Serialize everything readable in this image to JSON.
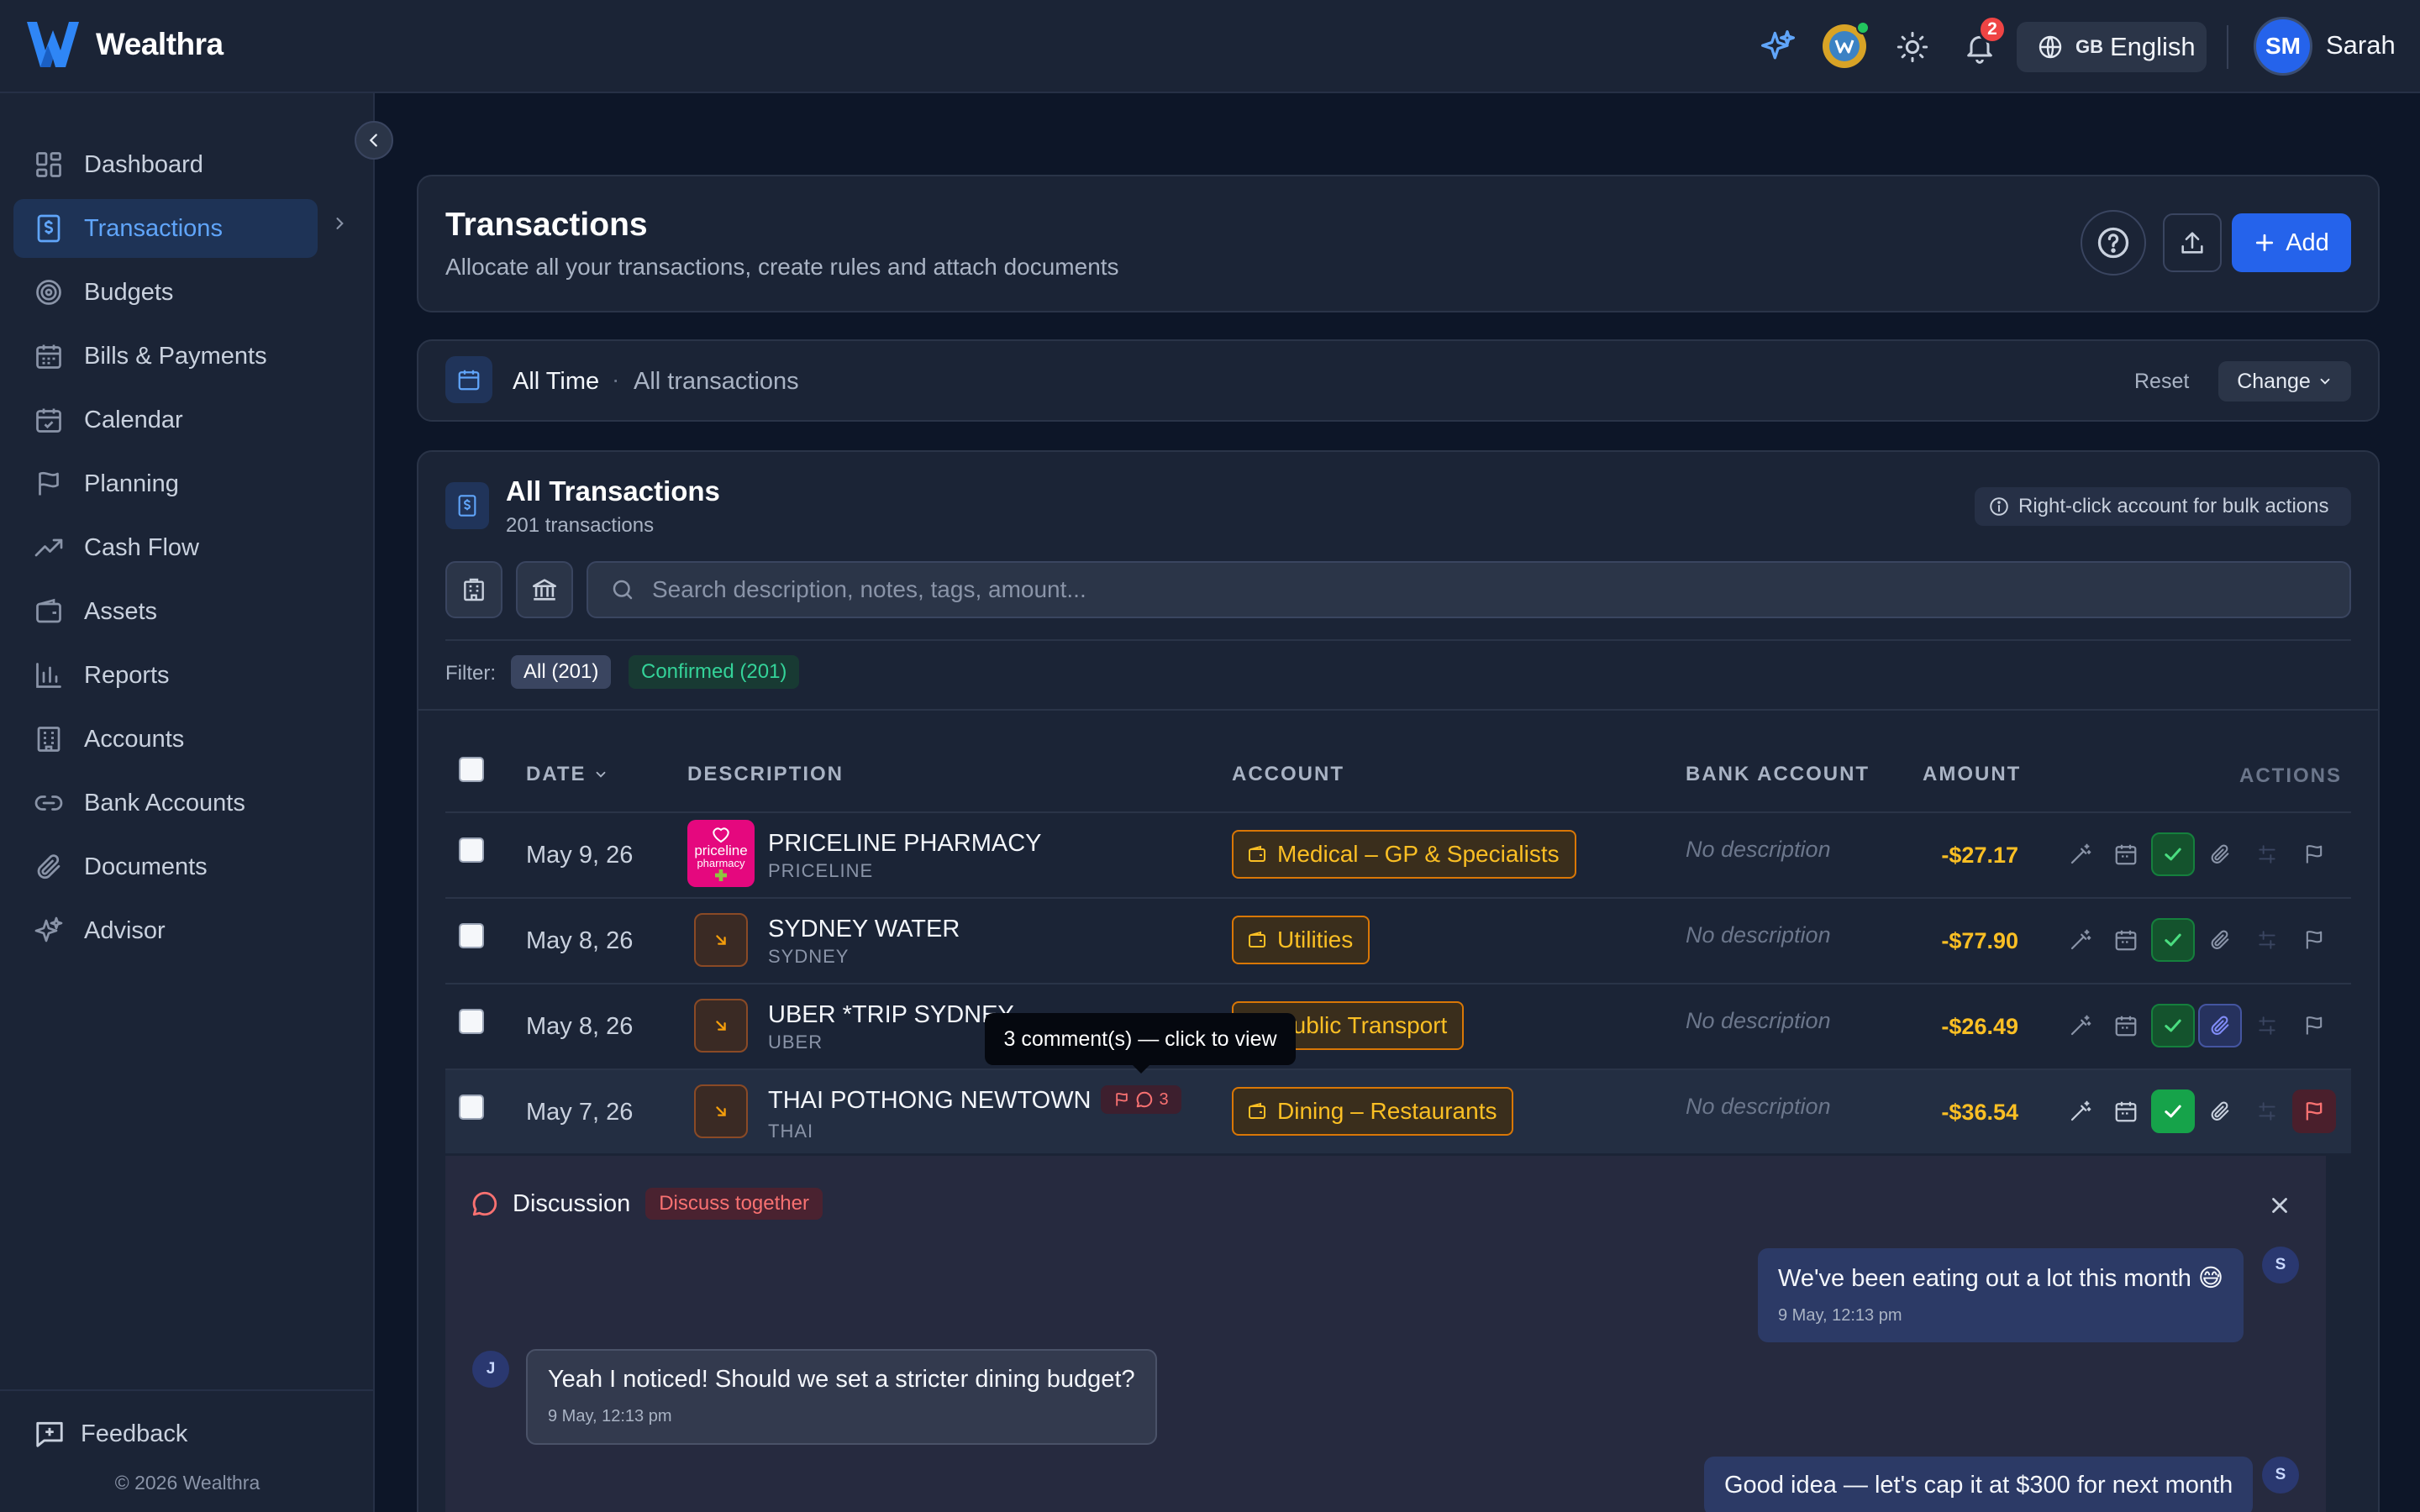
{
  "app": {
    "name": "Wealthra"
  },
  "topbar": {
    "notifications_count": "2",
    "language_flag": "GB",
    "language_label": "English",
    "user_initials": "SM",
    "user_name": "Sarah"
  },
  "sidebar": {
    "items": [
      {
        "label": "Dashboard",
        "icon": "dashboard-icon"
      },
      {
        "label": "Transactions",
        "icon": "receipt-dollar-icon",
        "active": true
      },
      {
        "label": "Budgets",
        "icon": "target-icon"
      },
      {
        "label": "Bills & Payments",
        "icon": "calendar-grid-icon"
      },
      {
        "label": "Calendar",
        "icon": "calendar-check-icon"
      },
      {
        "label": "Planning",
        "icon": "flag-icon"
      },
      {
        "label": "Cash Flow",
        "icon": "trending-up-icon"
      },
      {
        "label": "Assets",
        "icon": "wallet-icon"
      },
      {
        "label": "Reports",
        "icon": "bar-chart-icon"
      },
      {
        "label": "Accounts",
        "icon": "building-icon"
      },
      {
        "label": "Bank Accounts",
        "icon": "link-icon"
      },
      {
        "label": "Documents",
        "icon": "paperclip-icon"
      },
      {
        "label": "Advisor",
        "icon": "sparkles-icon"
      }
    ],
    "feedback_label": "Feedback",
    "copyright": "© 2026 Wealthra"
  },
  "header": {
    "title": "Transactions",
    "subtitle": "Allocate all your transactions, create rules and attach documents",
    "add_label": "Add"
  },
  "date_range": {
    "label": "All Time",
    "separator": "·",
    "sublabel": "All transactions",
    "reset_label": "Reset",
    "change_label": "Change"
  },
  "transactions": {
    "title": "All Transactions",
    "count": "201 transactions",
    "bulk_hint": "Right-click account for bulk actions",
    "search_placeholder": "Search description, notes, tags, amount...",
    "filter_label": "Filter:",
    "filters": {
      "all": "All (201)",
      "confirmed": "Confirmed (201)"
    },
    "columns": {
      "date": "DATE",
      "description": "DESCRIPTION",
      "account": "ACCOUNT",
      "bank_account": "BANK ACCOUNT",
      "amount": "AMOUNT",
      "actions": "ACTIONS"
    },
    "rows": [
      {
        "date": "May 9, 26",
        "name": "PRICELINE PHARMACY",
        "sub": "PRICELINE",
        "account": "Medical – GP & Specialists",
        "bank": "No description",
        "amount": "-$27.17"
      },
      {
        "date": "May 8, 26",
        "name": "SYDNEY WATER",
        "sub": "SYDNEY",
        "account": "Utilities",
        "bank": "No description",
        "amount": "-$77.90"
      },
      {
        "date": "May 8, 26",
        "name": "UBER *TRIP SYDNEY",
        "sub": "UBER",
        "account": "Public Transport",
        "bank": "No description",
        "amount": "-$26.49"
      },
      {
        "date": "May 7, 26",
        "name": "THAI POTHONG NEWTOWN",
        "sub": "THAI",
        "account": "Dining – Restaurants",
        "bank": "No description",
        "amount": "-$36.54",
        "comments": "3"
      }
    ],
    "logo_text": {
      "line1": "priceline",
      "line2": "pharmacy"
    },
    "tooltip": "3 comment(s) — click to view"
  },
  "discussion": {
    "title": "Discussion",
    "tag": "Discuss together",
    "messages": [
      {
        "author": "S",
        "text": "We've been eating out a lot this month 😅",
        "time": "9 May, 12:13 pm"
      },
      {
        "author": "J",
        "text": "Yeah I noticed! Should we set a stricter dining budget?",
        "time": "9 May, 12:13 pm"
      },
      {
        "author": "S",
        "text": "Good idea — let's cap it at $300 for next month",
        "time": ""
      }
    ]
  },
  "colors": {
    "accent": "#2563eb",
    "amount": "#fbbf24",
    "confirmed": "#34d399",
    "danger": "#ef4444"
  }
}
